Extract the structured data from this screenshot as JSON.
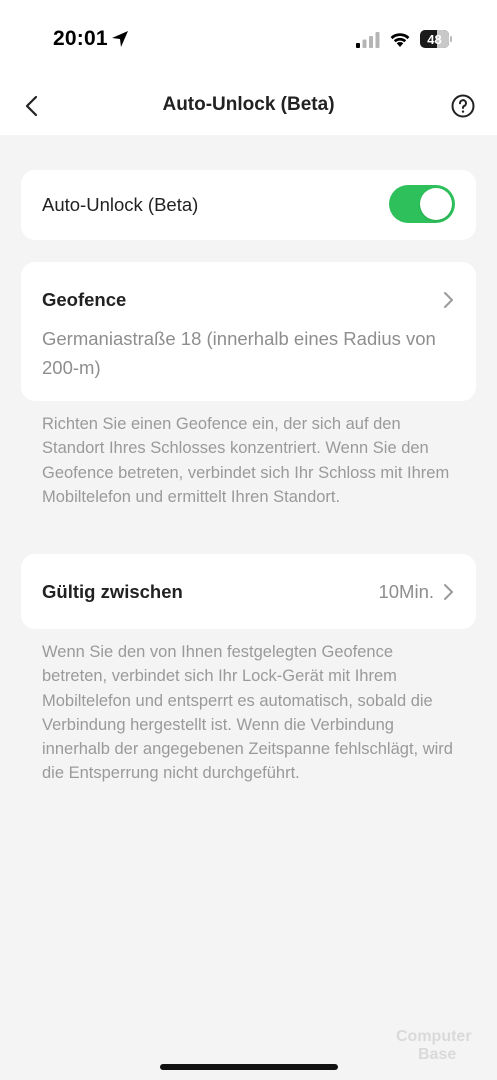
{
  "status_bar": {
    "time": "20:01",
    "battery": "48",
    "icons": [
      "location-arrow-icon",
      "cellular-signal-icon",
      "wifi-icon",
      "battery-icon"
    ]
  },
  "nav": {
    "title": "Auto-Unlock (Beta)",
    "back_icon": "chevron-left-icon",
    "help_icon": "question-circle-icon"
  },
  "auto_unlock": {
    "label": "Auto-Unlock (Beta)",
    "enabled": true,
    "toggle_color": "#2ec15b"
  },
  "geofence": {
    "title": "Geofence",
    "address": "Germaniastraße 18 (innerhalb eines Radius von 200-m)",
    "description": "Richten Sie einen Geofence ein, der sich auf den Standort Ihres Schlosses konzentriert. Wenn Sie den Geofence betreten, verbindet sich Ihr Schloss mit Ihrem Mobiltelefon und ermittelt Ihren Standort."
  },
  "valid_between": {
    "title": "Gültig zwischen",
    "value": "10Min.",
    "description": "Wenn Sie den von Ihnen festgelegten Geofence betreten, verbindet sich Ihr Lock-Gerät mit Ihrem Mobiltelefon und entsperrt es automatisch, sobald die Verbindung hergestellt ist. Wenn die Verbindung innerhalb der angegebenen Zeitspanne fehlschlägt, wird die Entsperrung nicht durchgeführt."
  },
  "watermark": {
    "line1": "Computer",
    "line2": "Base"
  }
}
